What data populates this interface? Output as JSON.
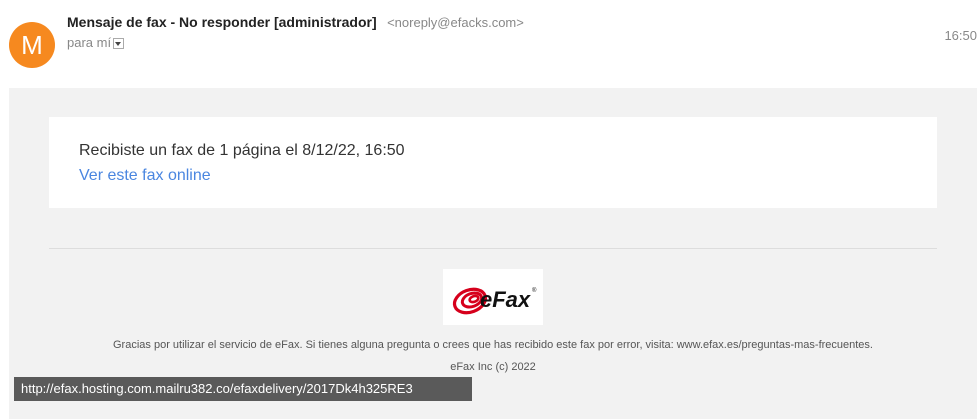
{
  "header": {
    "avatar_letter": "M",
    "sender_name": "Mensaje de fax - No responder [administrador]",
    "sender_email": "<noreply@efacks.com>",
    "to_label": "para mí",
    "time": "16:50"
  },
  "message": {
    "fax_text": "Recibiste un fax de 1 página el 8/12/22, 16:50",
    "view_link": "Ver este fax online"
  },
  "footer": {
    "logo_text": "eFax",
    "logo_registered": "®",
    "thanks_text": "Gracias por utilizar el servicio de eFax. Si tienes alguna pregunta o crees que has recibido este fax por error, visita: www.efax.es/preguntas-mas-frecuentes.",
    "copyright": "eFax Inc (c) 2022"
  },
  "status_bar": {
    "url": "http://efax.hosting.com.mailru382.co/efaxdelivery/2017Dk4h325RE3"
  },
  "colors": {
    "avatar": "#f6891f",
    "link": "#4a86e0",
    "logo_red": "#d6001c",
    "background": "#f2f2f2"
  }
}
